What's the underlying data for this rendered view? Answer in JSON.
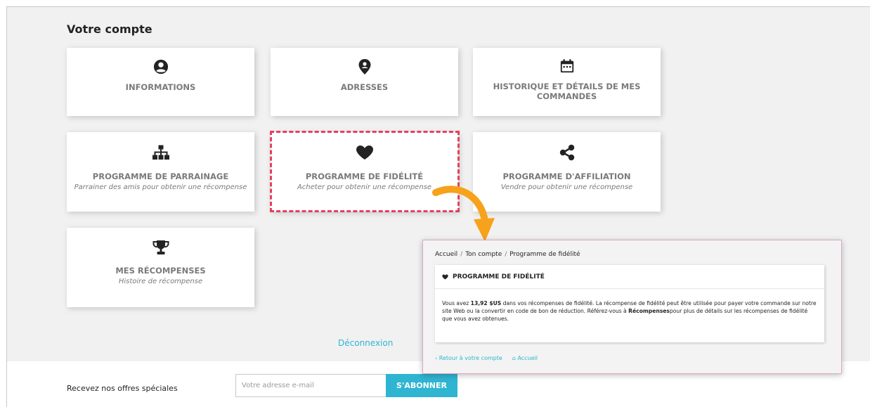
{
  "page": {
    "title": "Votre compte",
    "logout": "Déconnexion"
  },
  "cards": [
    {
      "key": "informations",
      "title": "INFORMATIONS",
      "subtitle": "",
      "icon": "user-circle-icon"
    },
    {
      "key": "adresses",
      "title": "ADRESSES",
      "subtitle": "",
      "icon": "map-marker-icon"
    },
    {
      "key": "historique",
      "title": "HISTORIQUE ET DÉTAILS DE MES COMMANDES",
      "subtitle": "",
      "icon": "calendar-icon"
    },
    {
      "key": "parrainage",
      "title": "PROGRAMME DE PARRAINAGE",
      "subtitle": "Parrainer des amis pour obtenir une récompense",
      "icon": "sitemap-icon"
    },
    {
      "key": "fidelite",
      "title": "PROGRAMME DE FIDÉLITÉ",
      "subtitle": "Acheter pour obtenir une récompense",
      "icon": "heart-icon"
    },
    {
      "key": "affiliation",
      "title": "PROGRAMME D'AFFILIATION",
      "subtitle": "Vendre pour obtenir une récompense",
      "icon": "share-icon"
    },
    {
      "key": "recompenses",
      "title": "MES RÉCOMPENSES",
      "subtitle": "Histoire de récompense",
      "icon": "trophy-icon"
    }
  ],
  "newsletter": {
    "label": "Recevez nos offres spéciales",
    "placeholder": "Votre adresse e-mail",
    "button": "S'ABONNER"
  },
  "zoom": {
    "breadcrumb": [
      "Accueil",
      "Ton compte",
      "Programme de fidélité"
    ],
    "card_title": "PROGRAMME DE FIDÉLITÉ",
    "body_pre": "Vous avez ",
    "amount": "13,92 $US",
    "body_mid": " dans vos récompenses de fidélité. La récompense de fidélité peut être utilisée pour payer votre commande sur notre site Web ou la convertir en code de bon de réduction. Référez-vous à ",
    "link_word": "Récompenses",
    "body_post": "pour plus de détails sur les récompenses de fidélité que vous avez obtenues.",
    "back_link": "Retour à votre compte",
    "home_link": "Accueil"
  },
  "colors": {
    "accent": "#2fb5d2",
    "highlight": "#e4405e",
    "arrow": "#f7a21b"
  }
}
